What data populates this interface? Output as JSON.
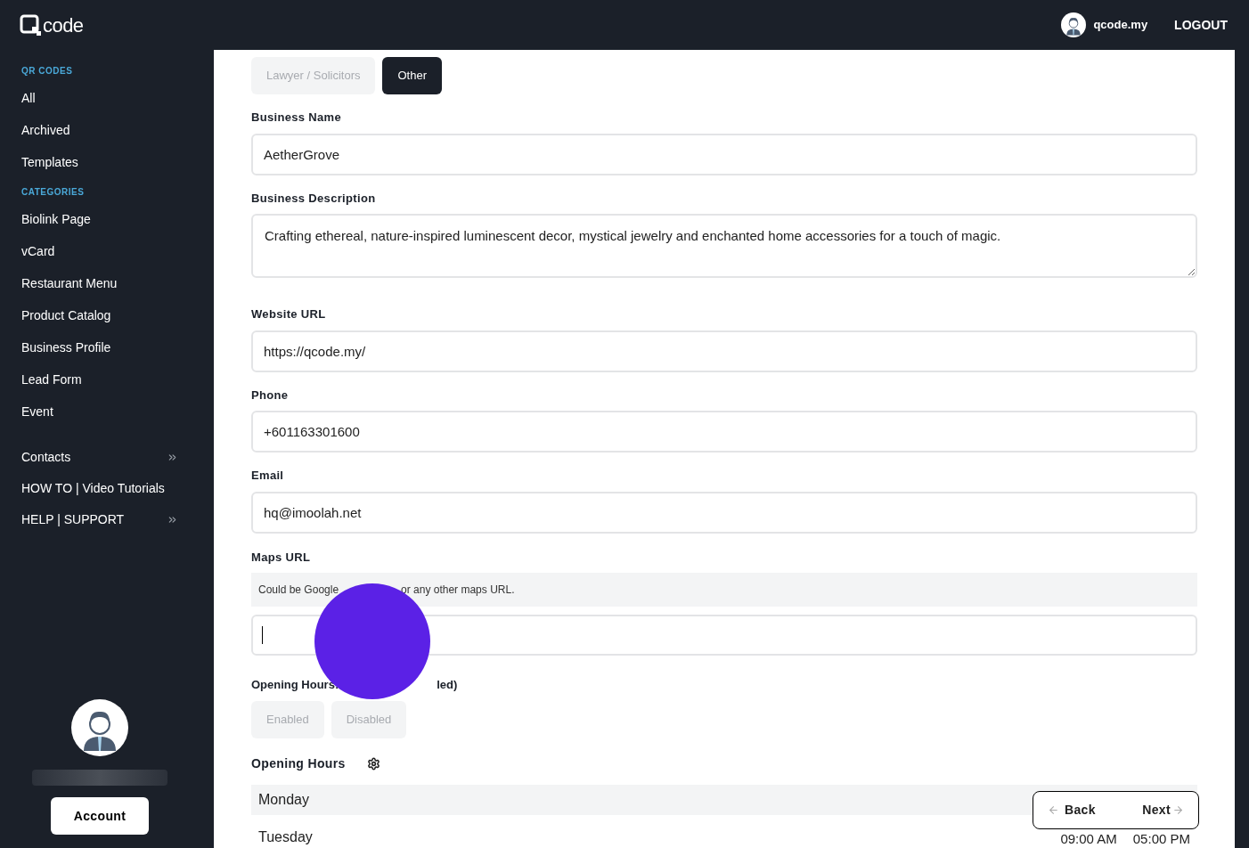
{
  "header": {
    "logo": "code",
    "user": "qcode.my",
    "logout": "LOGOUT"
  },
  "sidebar": {
    "sections": [
      {
        "title": "QR CODES",
        "items": [
          {
            "label": "All",
            "submenu": false
          },
          {
            "label": "Archived",
            "submenu": false
          },
          {
            "label": "Templates",
            "submenu": false
          }
        ]
      },
      {
        "title": "CATEGORIES",
        "items": [
          {
            "label": "Biolink Page",
            "submenu": false
          },
          {
            "label": "vCard",
            "submenu": false
          },
          {
            "label": "Restaurant Menu",
            "submenu": false
          },
          {
            "label": "Product Catalog",
            "submenu": false
          },
          {
            "label": "Business Profile",
            "submenu": false
          },
          {
            "label": "Lead Form",
            "submenu": false
          },
          {
            "label": "Event",
            "submenu": false
          }
        ]
      },
      {
        "items": [
          {
            "label": "Contacts",
            "submenu": true
          },
          {
            "label": "HOW TO | Video Tutorials",
            "submenu": false
          },
          {
            "label": "HELP | SUPPORT",
            "submenu": true
          }
        ]
      }
    ],
    "account": "Account"
  },
  "business_types": [
    {
      "label": "Lawyer / Solicitors",
      "selected": false
    },
    {
      "label": "Other",
      "selected": true
    }
  ],
  "fields": [
    {
      "kind": "input",
      "label": "Business Name",
      "value": "AetherGrove"
    },
    {
      "kind": "textarea",
      "label": "Business Description",
      "value": "Crafting ethereal, nature-inspired luminescent decor, mystical jewelry and enchanted home accessories for a touch of magic."
    },
    {
      "kind": "input",
      "label": "Website URL",
      "value": "https://qcode.my/"
    },
    {
      "kind": "input",
      "label": "Phone",
      "value": "+601163301600"
    },
    {
      "kind": "input",
      "label": "Email",
      "value": "hq@imoolah.net"
    }
  ],
  "maps": {
    "label": "Maps URL",
    "hint_before": "Could be Google",
    "hint_after": "or any other maps URL."
  },
  "opening_toggle": {
    "label_before": "Opening Hours:",
    "label_after": "led)",
    "options": [
      {
        "label": "Enabled",
        "selected": false
      },
      {
        "label": "Disabled",
        "selected": false
      }
    ]
  },
  "opening_hours": {
    "title": "Opening Hours",
    "days": [
      {
        "day": "Monday"
      },
      {
        "day": "Tuesday",
        "open": "09:00 AM",
        "close": "05:00 PM"
      }
    ]
  },
  "nav": {
    "back": "Back",
    "next": "Next"
  }
}
